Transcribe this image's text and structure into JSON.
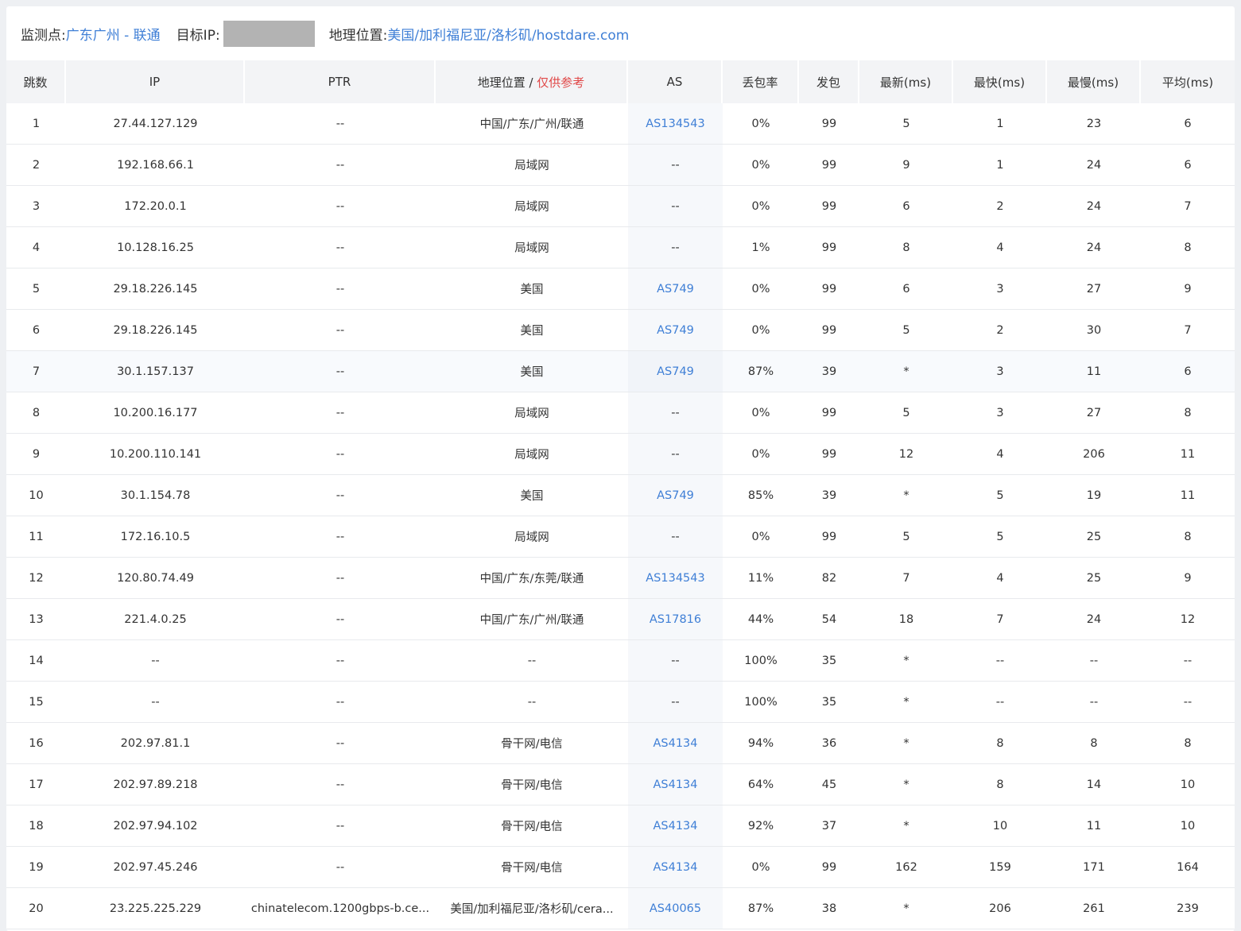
{
  "header": {
    "monitor_label": "监测点:",
    "monitor_value": "广东广州 - 联通",
    "target_label": "目标IP:",
    "geo_label": "地理位置:",
    "geo_value": "美国/加利福尼亚/洛杉矶/hostdare.com"
  },
  "columns": {
    "hop": "跳数",
    "ip": "IP",
    "ptr": "PTR",
    "geo": "地理位置 /",
    "geo_note": "仅供参考",
    "as": "AS",
    "loss": "丢包率",
    "sent": "发包",
    "last": "最新(ms)",
    "best": "最快(ms)",
    "worst": "最慢(ms)",
    "avg": "平均(ms)"
  },
  "rows": [
    {
      "hop": "1",
      "ip": "27.44.127.129",
      "ptr": "--",
      "geo": "中国/广东/广州/联通",
      "as": "AS134543",
      "loss": "0%",
      "sent": "99",
      "last": "5",
      "best": "1",
      "worst": "23",
      "avg": "6"
    },
    {
      "hop": "2",
      "ip": "192.168.66.1",
      "ptr": "--",
      "geo": "局域网",
      "as": "--",
      "loss": "0%",
      "sent": "99",
      "last": "9",
      "best": "1",
      "worst": "24",
      "avg": "6"
    },
    {
      "hop": "3",
      "ip": "172.20.0.1",
      "ptr": "--",
      "geo": "局域网",
      "as": "--",
      "loss": "0%",
      "sent": "99",
      "last": "6",
      "best": "2",
      "worst": "24",
      "avg": "7"
    },
    {
      "hop": "4",
      "ip": "10.128.16.25",
      "ptr": "--",
      "geo": "局域网",
      "as": "--",
      "loss": "1%",
      "sent": "99",
      "last": "8",
      "best": "4",
      "worst": "24",
      "avg": "8"
    },
    {
      "hop": "5",
      "ip": "29.18.226.145",
      "ptr": "--",
      "geo": "美国",
      "as": "AS749",
      "loss": "0%",
      "sent": "99",
      "last": "6",
      "best": "3",
      "worst": "27",
      "avg": "9"
    },
    {
      "hop": "6",
      "ip": "29.18.226.145",
      "ptr": "--",
      "geo": "美国",
      "as": "AS749",
      "loss": "0%",
      "sent": "99",
      "last": "5",
      "best": "2",
      "worst": "30",
      "avg": "7"
    },
    {
      "hop": "7",
      "ip": "30.1.157.137",
      "ptr": "--",
      "geo": "美国",
      "as": "AS749",
      "loss": "87%",
      "sent": "39",
      "last": "*",
      "best": "3",
      "worst": "11",
      "avg": "6"
    },
    {
      "hop": "8",
      "ip": "10.200.16.177",
      "ptr": "--",
      "geo": "局域网",
      "as": "--",
      "loss": "0%",
      "sent": "99",
      "last": "5",
      "best": "3",
      "worst": "27",
      "avg": "8"
    },
    {
      "hop": "9",
      "ip": "10.200.110.141",
      "ptr": "--",
      "geo": "局域网",
      "as": "--",
      "loss": "0%",
      "sent": "99",
      "last": "12",
      "best": "4",
      "worst": "206",
      "avg": "11"
    },
    {
      "hop": "10",
      "ip": "30.1.154.78",
      "ptr": "--",
      "geo": "美国",
      "as": "AS749",
      "loss": "85%",
      "sent": "39",
      "last": "*",
      "best": "5",
      "worst": "19",
      "avg": "11"
    },
    {
      "hop": "11",
      "ip": "172.16.10.5",
      "ptr": "--",
      "geo": "局域网",
      "as": "--",
      "loss": "0%",
      "sent": "99",
      "last": "5",
      "best": "5",
      "worst": "25",
      "avg": "8"
    },
    {
      "hop": "12",
      "ip": "120.80.74.49",
      "ptr": "--",
      "geo": "中国/广东/东莞/联通",
      "as": "AS134543",
      "loss": "11%",
      "sent": "82",
      "last": "7",
      "best": "4",
      "worst": "25",
      "avg": "9"
    },
    {
      "hop": "13",
      "ip": "221.4.0.25",
      "ptr": "--",
      "geo": "中国/广东/广州/联通",
      "as": "AS17816",
      "loss": "44%",
      "sent": "54",
      "last": "18",
      "best": "7",
      "worst": "24",
      "avg": "12"
    },
    {
      "hop": "14",
      "ip": "--",
      "ptr": "--",
      "geo": "--",
      "as": "--",
      "loss": "100%",
      "sent": "35",
      "last": "*",
      "best": "--",
      "worst": "--",
      "avg": "--"
    },
    {
      "hop": "15",
      "ip": "--",
      "ptr": "--",
      "geo": "--",
      "as": "--",
      "loss": "100%",
      "sent": "35",
      "last": "*",
      "best": "--",
      "worst": "--",
      "avg": "--"
    },
    {
      "hop": "16",
      "ip": "202.97.81.1",
      "ptr": "--",
      "geo": "骨干网/电信",
      "as": "AS4134",
      "loss": "94%",
      "sent": "36",
      "last": "*",
      "best": "8",
      "worst": "8",
      "avg": "8"
    },
    {
      "hop": "17",
      "ip": "202.97.89.218",
      "ptr": "--",
      "geo": "骨干网/电信",
      "as": "AS4134",
      "loss": "64%",
      "sent": "45",
      "last": "*",
      "best": "8",
      "worst": "14",
      "avg": "10"
    },
    {
      "hop": "18",
      "ip": "202.97.94.102",
      "ptr": "--",
      "geo": "骨干网/电信",
      "as": "AS4134",
      "loss": "92%",
      "sent": "37",
      "last": "*",
      "best": "10",
      "worst": "11",
      "avg": "10"
    },
    {
      "hop": "19",
      "ip": "202.97.45.246",
      "ptr": "--",
      "geo": "骨干网/电信",
      "as": "AS4134",
      "loss": "0%",
      "sent": "99",
      "last": "162",
      "best": "159",
      "worst": "171",
      "avg": "164"
    },
    {
      "hop": "20",
      "ip": "23.225.225.229",
      "ptr": "chinatelecom.1200gbps-b.ce...",
      "geo": "美国/加利福尼亚/洛杉矶/cera...",
      "as": "AS40065",
      "loss": "87%",
      "sent": "38",
      "last": "*",
      "best": "206",
      "worst": "261",
      "avg": "239"
    }
  ],
  "highlighted_hop": "7",
  "colors": {
    "link": "#3f7fd6",
    "warn": "#e04848",
    "header_bg": "#f3f4f6",
    "ip_mask": "#b3b3b3"
  }
}
